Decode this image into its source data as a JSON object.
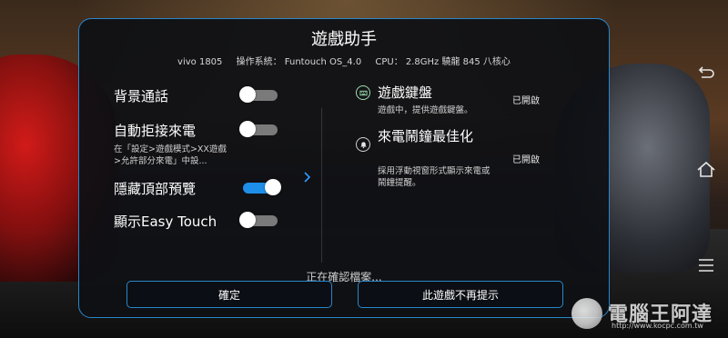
{
  "dialog": {
    "title": "遊戲助手",
    "device_info": {
      "model": "vivo 1805",
      "os": "操作系統： Funtouch OS_4.0",
      "cpu": "CPU： 2.8GHz 驍龍 845 八核心"
    }
  },
  "settings": [
    {
      "label": "背景通話",
      "state": "off"
    },
    {
      "label": "自動拒接來電",
      "state": "off",
      "description": "在「設定>遊戲模式>XX遊戲>允許部分來電」中設..."
    },
    {
      "label": "隱藏頂部預覽",
      "state": "on"
    },
    {
      "label": "顯示Easy Touch",
      "state": "off"
    }
  ],
  "options": [
    {
      "title": "遊戲鍵盤",
      "description": "遊戲中，提供遊戲鍵盤。",
      "status": "已開啟",
      "icon": "keyboard-icon"
    },
    {
      "title": "來電鬧鐘最佳化",
      "description": "採用浮動視窗形式顯示來電或鬧鐘提醒。",
      "status": "已開啟",
      "icon": "bell-icon"
    }
  ],
  "loading_text": "正在確認檔案...",
  "buttons": {
    "confirm": "確定",
    "dont_remind": "此遊戲不再提示"
  },
  "watermark": {
    "text": "電腦王阿達",
    "url": "http://www.kocpc.com.tw"
  },
  "colors": {
    "accent": "#2a86c9",
    "toggle_on": "#1e8fe8",
    "toggle_off": "#7a7a7a",
    "icon_ring": "#9de0b5"
  }
}
